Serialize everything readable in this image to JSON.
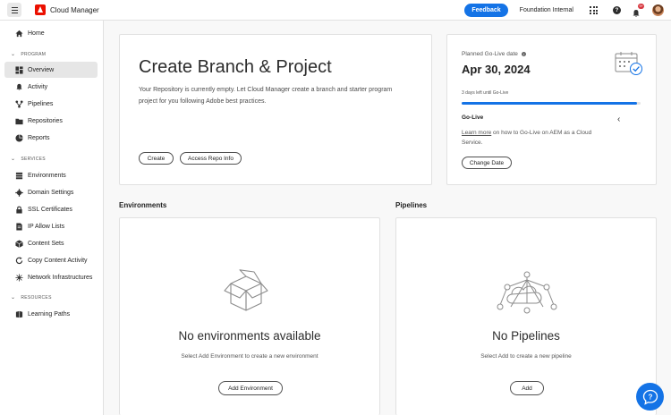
{
  "topbar": {
    "app_title": "Cloud Manager",
    "feedback_label": "Feedback",
    "org_name": "Foundation Internal",
    "notification_badge": "9+",
    "help_glyph": "?"
  },
  "sidebar": {
    "items": [
      {
        "label": "Home",
        "icon": "home-icon"
      },
      {
        "label": "Overview",
        "icon": "overview-icon",
        "active": true
      },
      {
        "label": "Activity",
        "icon": "bell-icon"
      },
      {
        "label": "Pipelines",
        "icon": "pipelines-icon"
      },
      {
        "label": "Repositories",
        "icon": "repositories-icon"
      },
      {
        "label": "Reports",
        "icon": "reports-icon"
      },
      {
        "label": "Environments",
        "icon": "environments-icon"
      },
      {
        "label": "Domain Settings",
        "icon": "gear-icon"
      },
      {
        "label": "SSL Certificates",
        "icon": "lock-icon"
      },
      {
        "label": "IP Allow Lists",
        "icon": "document-icon"
      },
      {
        "label": "Content Sets",
        "icon": "box-icon"
      },
      {
        "label": "Copy Content Activity",
        "icon": "sync-icon"
      },
      {
        "label": "Network Infrastructures",
        "icon": "network-icon"
      },
      {
        "label": "Learning Paths",
        "icon": "learning-icon"
      }
    ],
    "sections": {
      "program": "PROGRAM",
      "services": "SERVICES",
      "resources": "RESOURCES"
    }
  },
  "hero": {
    "title": "Create Branch & Project",
    "description": "Your Repository is currently empty. Let Cloud Manager create a branch and starter program project for you following Adobe best practices.",
    "create_label": "Create",
    "access_label": "Access Repo Info"
  },
  "golive": {
    "label": "Planned Go-Live date",
    "date": "Apr 30, 2024",
    "days_left": "3 days left until Go-Live",
    "progress_fraction": 0.98,
    "section_title": "Go-Live",
    "learn_more": "Learn more",
    "info_text": " on how to Go-Live on AEM as a Cloud Service.",
    "change_date_label": "Change Date"
  },
  "environments": {
    "title": "Environments",
    "empty_title": "No environments available",
    "empty_desc": "Select Add Environment to create a new environment",
    "add_label": "Add Environment"
  },
  "pipelines": {
    "title": "Pipelines",
    "empty_title": "No Pipelines",
    "empty_desc": "Select Add to create a new pipeline",
    "add_label": "Add"
  },
  "colors": {
    "accent": "#1473e6",
    "adobe_red": "#eb1000",
    "badge_red": "#d7373f"
  }
}
